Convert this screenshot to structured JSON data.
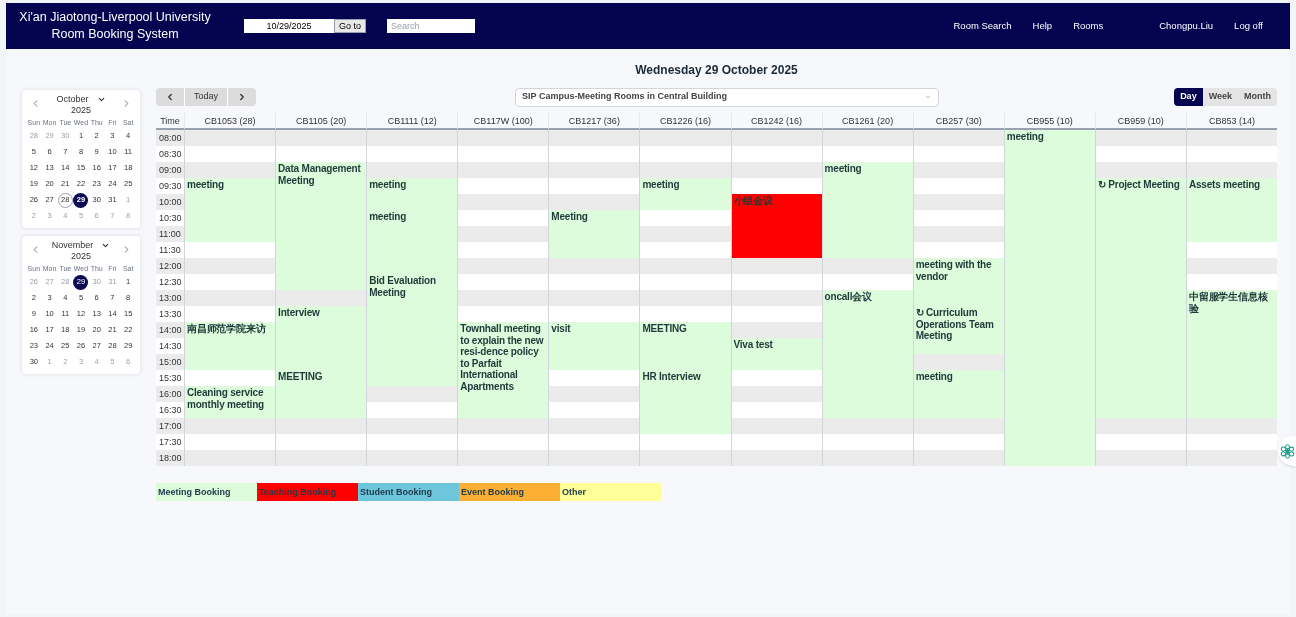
{
  "header": {
    "title_lines": [
      "Xi'an Jiaotong-Liverpool University",
      "Room Booking System"
    ],
    "date_field": {
      "value": "10/29/2025"
    },
    "goto_button": "Go to",
    "search": {
      "placeholder": "Search"
    },
    "nav_links": [
      "Room Search",
      "Help",
      "Rooms"
    ],
    "user": "Chongpu.Liu",
    "logoff": "Log off"
  },
  "date_heading": "Wednesday 29 October 2025",
  "mini_calendars": [
    {
      "month": "October",
      "year": "2025",
      "weekdays": [
        "Sun",
        "Mon",
        "Tue",
        "Wed",
        "Thu",
        "Fri",
        "Sat"
      ],
      "weeks": [
        [
          {
            "d": "28",
            "muted": true
          },
          {
            "d": "29",
            "muted": true
          },
          {
            "d": "30",
            "muted": true
          },
          {
            "d": "1",
            "muted": false
          },
          {
            "d": "2",
            "muted": false
          },
          {
            "d": "3",
            "muted": false
          },
          {
            "d": "4",
            "muted": false
          }
        ],
        [
          {
            "d": "5",
            "muted": false
          },
          {
            "d": "6",
            "muted": false
          },
          {
            "d": "7",
            "muted": false
          },
          {
            "d": "8",
            "muted": false
          },
          {
            "d": "9",
            "muted": false
          },
          {
            "d": "10",
            "muted": false
          },
          {
            "d": "11",
            "muted": false
          }
        ],
        [
          {
            "d": "12",
            "muted": false
          },
          {
            "d": "13",
            "muted": false
          },
          {
            "d": "14",
            "muted": false
          },
          {
            "d": "15",
            "muted": false
          },
          {
            "d": "16",
            "muted": false
          },
          {
            "d": "17",
            "muted": false
          },
          {
            "d": "18",
            "muted": false
          }
        ],
        [
          {
            "d": "19",
            "muted": false
          },
          {
            "d": "20",
            "muted": false
          },
          {
            "d": "21",
            "muted": false
          },
          {
            "d": "22",
            "muted": false
          },
          {
            "d": "23",
            "muted": false
          },
          {
            "d": "24",
            "muted": false
          },
          {
            "d": "25",
            "muted": false
          }
        ],
        [
          {
            "d": "26",
            "muted": false
          },
          {
            "d": "27",
            "muted": false
          },
          {
            "d": "28",
            "muted": false,
            "outlined": true
          },
          {
            "d": "29",
            "muted": false,
            "selected": true
          },
          {
            "d": "30",
            "muted": false
          },
          {
            "d": "31",
            "muted": false
          },
          {
            "d": "1",
            "muted": true
          }
        ],
        [
          {
            "d": "2",
            "muted": true
          },
          {
            "d": "3",
            "muted": true
          },
          {
            "d": "4",
            "muted": true
          },
          {
            "d": "5",
            "muted": true
          },
          {
            "d": "6",
            "muted": true
          },
          {
            "d": "7",
            "muted": true
          },
          {
            "d": "8",
            "muted": true
          }
        ]
      ]
    },
    {
      "month": "November",
      "year": "2025",
      "weekdays": [
        "Sun",
        "Mon",
        "Tue",
        "Wed",
        "Thu",
        "Fri",
        "Sat"
      ],
      "weeks": [
        [
          {
            "d": "26",
            "muted": true
          },
          {
            "d": "27",
            "muted": true
          },
          {
            "d": "28",
            "muted": true
          },
          {
            "d": "29",
            "muted": true,
            "selected": true
          },
          {
            "d": "30",
            "muted": true
          },
          {
            "d": "31",
            "muted": true
          },
          {
            "d": "1",
            "muted": false
          }
        ],
        [
          {
            "d": "2",
            "muted": false
          },
          {
            "d": "3",
            "muted": false
          },
          {
            "d": "4",
            "muted": false
          },
          {
            "d": "5",
            "muted": false
          },
          {
            "d": "6",
            "muted": false
          },
          {
            "d": "7",
            "muted": false
          },
          {
            "d": "8",
            "muted": false
          }
        ],
        [
          {
            "d": "9",
            "muted": false
          },
          {
            "d": "10",
            "muted": false
          },
          {
            "d": "11",
            "muted": false
          },
          {
            "d": "12",
            "muted": false
          },
          {
            "d": "13",
            "muted": false
          },
          {
            "d": "14",
            "muted": false
          },
          {
            "d": "15",
            "muted": false
          }
        ],
        [
          {
            "d": "16",
            "muted": false
          },
          {
            "d": "17",
            "muted": false
          },
          {
            "d": "18",
            "muted": false
          },
          {
            "d": "19",
            "muted": false
          },
          {
            "d": "20",
            "muted": false
          },
          {
            "d": "21",
            "muted": false
          },
          {
            "d": "22",
            "muted": false
          }
        ],
        [
          {
            "d": "23",
            "muted": false
          },
          {
            "d": "24",
            "muted": false
          },
          {
            "d": "25",
            "muted": false
          },
          {
            "d": "26",
            "muted": false
          },
          {
            "d": "27",
            "muted": false
          },
          {
            "d": "28",
            "muted": false
          },
          {
            "d": "29",
            "muted": false
          }
        ],
        [
          {
            "d": "30",
            "muted": false
          },
          {
            "d": "1",
            "muted": true
          },
          {
            "d": "2",
            "muted": true
          },
          {
            "d": "3",
            "muted": true
          },
          {
            "d": "4",
            "muted": true
          },
          {
            "d": "5",
            "muted": true
          },
          {
            "d": "6",
            "muted": true
          }
        ]
      ]
    }
  ],
  "toolbar": {
    "today": "Today",
    "room_group": {
      "value": "SIP Campus-Meeting Rooms in Central Building"
    },
    "views": [
      {
        "label": "Day",
        "selected": true
      },
      {
        "label": "Week",
        "selected": false
      },
      {
        "label": "Month",
        "selected": false
      }
    ]
  },
  "grid": {
    "time_heading": "Time",
    "times": [
      "08:00",
      "08:30",
      "09:00",
      "09:30",
      "10:00",
      "10:30",
      "11:00",
      "11:30",
      "12:00",
      "12:30",
      "13:00",
      "13:30",
      "14:00",
      "14:30",
      "15:00",
      "15:30",
      "16:00",
      "16:30",
      "17:00",
      "17:30",
      "18:00"
    ],
    "rooms": [
      {
        "name": "CB1053 (28)",
        "cells": [
          {
            "kind": "free"
          },
          {
            "kind": "free"
          },
          {
            "kind": "free"
          },
          {
            "kind": "booking",
            "title": "meeting",
            "color": "#dcfcdc"
          },
          {
            "kind": "more"
          },
          {
            "kind": "more"
          },
          {
            "kind": "more"
          },
          {
            "kind": "free"
          },
          {
            "kind": "free"
          },
          {
            "kind": "free"
          },
          {
            "kind": "free"
          },
          {
            "kind": "free"
          },
          {
            "kind": "booking",
            "title": "南昌师范学院来访",
            "color": "#dcfcdc"
          },
          {
            "kind": "more"
          },
          {
            "kind": "more"
          },
          {
            "kind": "free"
          },
          {
            "kind": "booking",
            "title": "Cleaning service monthly meeting",
            "color": "#dcfcdc"
          },
          {
            "kind": "more"
          },
          {
            "kind": "free"
          },
          {
            "kind": "free"
          },
          {
            "kind": "free"
          }
        ]
      },
      {
        "name": "CB1105 (20)",
        "cells": [
          {
            "kind": "free"
          },
          {
            "kind": "free"
          },
          {
            "kind": "booking",
            "title": "Data Management Meeting",
            "color": "#dcfcdc"
          },
          {
            "kind": "more"
          },
          {
            "kind": "more"
          },
          {
            "kind": "more"
          },
          {
            "kind": "more"
          },
          {
            "kind": "more"
          },
          {
            "kind": "more"
          },
          {
            "kind": "more"
          },
          {
            "kind": "free"
          },
          {
            "kind": "booking",
            "title": "Interview",
            "color": "#dcfcdc"
          },
          {
            "kind": "more"
          },
          {
            "kind": "more"
          },
          {
            "kind": "more"
          },
          {
            "kind": "booking",
            "title": "MEETING",
            "color": "#dcfcdc"
          },
          {
            "kind": "more"
          },
          {
            "kind": "more"
          },
          {
            "kind": "free"
          },
          {
            "kind": "free"
          },
          {
            "kind": "free"
          }
        ]
      },
      {
        "name": "CB1111 (12)",
        "cells": [
          {
            "kind": "free"
          },
          {
            "kind": "free"
          },
          {
            "kind": "free"
          },
          {
            "kind": "booking",
            "title": "meeting",
            "color": "#dcfcdc"
          },
          {
            "kind": "more"
          },
          {
            "kind": "booking",
            "title": "meeting",
            "color": "#dcfcdc"
          },
          {
            "kind": "more"
          },
          {
            "kind": "more"
          },
          {
            "kind": "more"
          },
          {
            "kind": "booking",
            "title": "Bid Evaluation Meeting",
            "color": "#dcfcdc"
          },
          {
            "kind": "more"
          },
          {
            "kind": "more"
          },
          {
            "kind": "more"
          },
          {
            "kind": "more"
          },
          {
            "kind": "more"
          },
          {
            "kind": "more"
          },
          {
            "kind": "free"
          },
          {
            "kind": "free"
          },
          {
            "kind": "free"
          },
          {
            "kind": "free"
          },
          {
            "kind": "free"
          }
        ]
      },
      {
        "name": "CB117W (100)",
        "cells": [
          {
            "kind": "free"
          },
          {
            "kind": "free"
          },
          {
            "kind": "free"
          },
          {
            "kind": "free"
          },
          {
            "kind": "free"
          },
          {
            "kind": "free"
          },
          {
            "kind": "free"
          },
          {
            "kind": "free"
          },
          {
            "kind": "free"
          },
          {
            "kind": "free"
          },
          {
            "kind": "free"
          },
          {
            "kind": "free"
          },
          {
            "kind": "booking",
            "title": "Townhall meeting to explain the new resi-dence policy to Parfait International Apartments",
            "color": "#dcfcdc"
          },
          {
            "kind": "more"
          },
          {
            "kind": "more"
          },
          {
            "kind": "more"
          },
          {
            "kind": "more"
          },
          {
            "kind": "more"
          },
          {
            "kind": "free"
          },
          {
            "kind": "free"
          },
          {
            "kind": "free"
          }
        ]
      },
      {
        "name": "CB1217 (36)",
        "cells": [
          {
            "kind": "free"
          },
          {
            "kind": "free"
          },
          {
            "kind": "free"
          },
          {
            "kind": "free"
          },
          {
            "kind": "free"
          },
          {
            "kind": "booking",
            "title": "Meeting",
            "color": "#dcfcdc"
          },
          {
            "kind": "more"
          },
          {
            "kind": "more"
          },
          {
            "kind": "free"
          },
          {
            "kind": "free"
          },
          {
            "kind": "free"
          },
          {
            "kind": "free"
          },
          {
            "kind": "booking",
            "title": "visit",
            "color": "#dcfcdc"
          },
          {
            "kind": "more"
          },
          {
            "kind": "more"
          },
          {
            "kind": "free"
          },
          {
            "kind": "free"
          },
          {
            "kind": "free"
          },
          {
            "kind": "free"
          },
          {
            "kind": "free"
          },
          {
            "kind": "free"
          }
        ]
      },
      {
        "name": "CB1226 (16)",
        "cells": [
          {
            "kind": "free"
          },
          {
            "kind": "free"
          },
          {
            "kind": "free"
          },
          {
            "kind": "booking",
            "title": "meeting",
            "color": "#dcfcdc"
          },
          {
            "kind": "more"
          },
          {
            "kind": "free"
          },
          {
            "kind": "free"
          },
          {
            "kind": "free"
          },
          {
            "kind": "free"
          },
          {
            "kind": "free"
          },
          {
            "kind": "free"
          },
          {
            "kind": "free"
          },
          {
            "kind": "booking",
            "title": "MEETING",
            "color": "#dcfcdc"
          },
          {
            "kind": "more"
          },
          {
            "kind": "more"
          },
          {
            "kind": "booking",
            "title": "HR Interview",
            "color": "#dcfcdc"
          },
          {
            "kind": "more"
          },
          {
            "kind": "more"
          },
          {
            "kind": "more"
          },
          {
            "kind": "free"
          },
          {
            "kind": "free"
          }
        ]
      },
      {
        "name": "CB1242 (16)",
        "cells": [
          {
            "kind": "free"
          },
          {
            "kind": "free"
          },
          {
            "kind": "free"
          },
          {
            "kind": "free"
          },
          {
            "kind": "booking",
            "title": "小组会议",
            "color": "#ff0000"
          },
          {
            "kind": "more"
          },
          {
            "kind": "more"
          },
          {
            "kind": "more"
          },
          {
            "kind": "free"
          },
          {
            "kind": "free"
          },
          {
            "kind": "free"
          },
          {
            "kind": "free"
          },
          {
            "kind": "free"
          },
          {
            "kind": "booking",
            "title": "Viva test",
            "color": "#dcfcdc"
          },
          {
            "kind": "more"
          },
          {
            "kind": "free"
          },
          {
            "kind": "free"
          },
          {
            "kind": "free"
          },
          {
            "kind": "free"
          },
          {
            "kind": "free"
          },
          {
            "kind": "free"
          }
        ]
      },
      {
        "name": "CB1261 (20)",
        "cells": [
          {
            "kind": "free"
          },
          {
            "kind": "free"
          },
          {
            "kind": "booking",
            "title": "meeting",
            "color": "#dcfcdc"
          },
          {
            "kind": "more"
          },
          {
            "kind": "more"
          },
          {
            "kind": "more"
          },
          {
            "kind": "more"
          },
          {
            "kind": "more"
          },
          {
            "kind": "free"
          },
          {
            "kind": "free"
          },
          {
            "kind": "booking",
            "title": "oncall会议",
            "color": "#dcfcdc"
          },
          {
            "kind": "more"
          },
          {
            "kind": "more"
          },
          {
            "kind": "more"
          },
          {
            "kind": "more"
          },
          {
            "kind": "more"
          },
          {
            "kind": "more"
          },
          {
            "kind": "more"
          },
          {
            "kind": "free"
          },
          {
            "kind": "free"
          },
          {
            "kind": "free"
          }
        ]
      },
      {
        "name": "CB257 (30)",
        "cells": [
          {
            "kind": "free"
          },
          {
            "kind": "free"
          },
          {
            "kind": "free"
          },
          {
            "kind": "free"
          },
          {
            "kind": "free"
          },
          {
            "kind": "free"
          },
          {
            "kind": "free"
          },
          {
            "kind": "free"
          },
          {
            "kind": "booking",
            "title": "meeting with the vendor",
            "color": "#dcfcdc"
          },
          {
            "kind": "more"
          },
          {
            "kind": "more"
          },
          {
            "kind": "booking",
            "prefix": "↻",
            "title": "Curriculum Operations Team Meeting",
            "color": "#dcfcdc"
          },
          {
            "kind": "more"
          },
          {
            "kind": "more"
          },
          {
            "kind": "free"
          },
          {
            "kind": "booking",
            "title": "meeting",
            "color": "#dcfcdc"
          },
          {
            "kind": "more"
          },
          {
            "kind": "more"
          },
          {
            "kind": "free"
          },
          {
            "kind": "free"
          },
          {
            "kind": "free"
          }
        ]
      },
      {
        "name": "CB955 (10)",
        "cells": [
          {
            "kind": "booking",
            "title": "meeting",
            "color": "#dcfcdc"
          },
          {
            "kind": "more"
          },
          {
            "kind": "more"
          },
          {
            "kind": "more"
          },
          {
            "kind": "more"
          },
          {
            "kind": "more"
          },
          {
            "kind": "more"
          },
          {
            "kind": "more"
          },
          {
            "kind": "more"
          },
          {
            "kind": "more"
          },
          {
            "kind": "more"
          },
          {
            "kind": "more"
          },
          {
            "kind": "more"
          },
          {
            "kind": "more"
          },
          {
            "kind": "more"
          },
          {
            "kind": "more"
          },
          {
            "kind": "more"
          },
          {
            "kind": "more"
          },
          {
            "kind": "more"
          },
          {
            "kind": "more"
          },
          {
            "kind": "more"
          }
        ]
      },
      {
        "name": "CB959 (10)",
        "cells": [
          {
            "kind": "free"
          },
          {
            "kind": "free"
          },
          {
            "kind": "free"
          },
          {
            "kind": "booking",
            "prefix": "↻",
            "title": "Project Meeting",
            "color": "#dcfcdc"
          },
          {
            "kind": "more"
          },
          {
            "kind": "more"
          },
          {
            "kind": "more"
          },
          {
            "kind": "more"
          },
          {
            "kind": "more"
          },
          {
            "kind": "more"
          },
          {
            "kind": "more"
          },
          {
            "kind": "more"
          },
          {
            "kind": "more"
          },
          {
            "kind": "more"
          },
          {
            "kind": "more"
          },
          {
            "kind": "more"
          },
          {
            "kind": "more"
          },
          {
            "kind": "more"
          },
          {
            "kind": "free"
          },
          {
            "kind": "free"
          },
          {
            "kind": "free"
          }
        ]
      },
      {
        "name": "CB853 (14)",
        "cells": [
          {
            "kind": "free"
          },
          {
            "kind": "free"
          },
          {
            "kind": "free"
          },
          {
            "kind": "booking",
            "title": "Assets meeting",
            "color": "#dcfcdc"
          },
          {
            "kind": "more"
          },
          {
            "kind": "more"
          },
          {
            "kind": "more"
          },
          {
            "kind": "free"
          },
          {
            "kind": "free"
          },
          {
            "kind": "free"
          },
          {
            "kind": "booking",
            "title": "中留服学生信息核验",
            "color": "#dcfcdc"
          },
          {
            "kind": "more"
          },
          {
            "kind": "more"
          },
          {
            "kind": "more"
          },
          {
            "kind": "more"
          },
          {
            "kind": "more"
          },
          {
            "kind": "more"
          },
          {
            "kind": "more"
          },
          {
            "kind": "free"
          },
          {
            "kind": "free"
          },
          {
            "kind": "free"
          }
        ]
      }
    ]
  },
  "legend": [
    {
      "label": "Meeting Booking",
      "color": "#dcfcdc"
    },
    {
      "label": "Teaching Booking",
      "color": "#ff0000"
    },
    {
      "label": "Student Booking",
      "color": "#6ec6dc"
    },
    {
      "label": "Event Booking",
      "color": "#fbb034"
    },
    {
      "label": "Other",
      "color": "#ffff99"
    }
  ]
}
